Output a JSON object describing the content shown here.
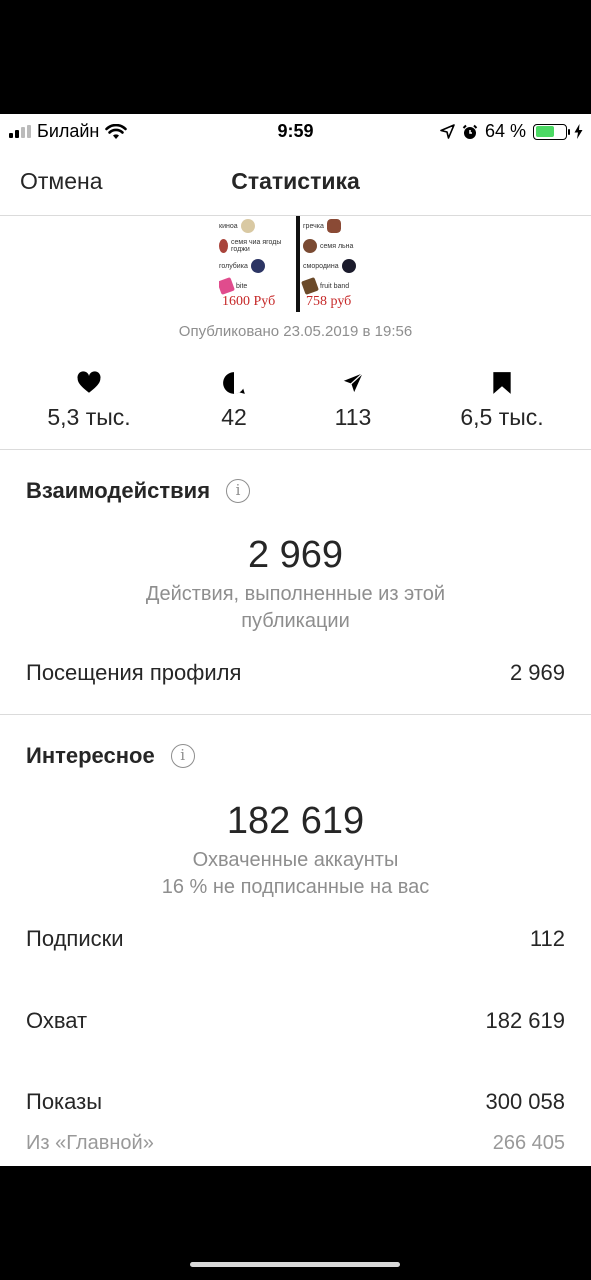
{
  "status_bar": {
    "carrier": "Билайн",
    "time": "9:59",
    "battery_text": "64 %",
    "battery_level": 0.64,
    "battery_color": "#4cd964"
  },
  "nav": {
    "cancel": "Отмена",
    "title": "Статистика"
  },
  "post": {
    "items_left": [
      "киноа",
      "семя чиа ягоды годжи",
      "голубика",
      "bite"
    ],
    "items_right": [
      "гречка",
      "семя льна",
      "смородина",
      "fruit band"
    ],
    "price_left": "1600 Руб",
    "price_right": "758 руб",
    "published": "Опубликовано 23.05.2019 в 19:56"
  },
  "stats": {
    "likes": "5,3 тыс.",
    "comments": "42",
    "shares": "113",
    "saves": "6,5 тыс."
  },
  "interactions": {
    "title": "Взаимодействия",
    "total": "2 969",
    "total_caption": "Действия, выполненные из этой публикации",
    "profile_visits_label": "Посещения профиля",
    "profile_visits_value": "2 969"
  },
  "discovery": {
    "title": "Интересное",
    "reach_total": "182 619",
    "caption1": "Охваченные аккаунты",
    "caption2": "16 % не подписанные на вас",
    "rows": [
      {
        "label": "Подписки",
        "value": "112"
      },
      {
        "label": "Охват",
        "value": "182 619"
      },
      {
        "label": "Показы",
        "value": "300 058"
      }
    ],
    "home_label": "Из «Главной»",
    "home_value": "266 405"
  },
  "icons": [
    "signal-icon",
    "wifi-icon",
    "location-arrow-icon",
    "alarm-icon",
    "battery-icon",
    "charging-icon",
    "heart-icon",
    "comment-icon",
    "send-icon",
    "bookmark-icon",
    "info-icon"
  ]
}
